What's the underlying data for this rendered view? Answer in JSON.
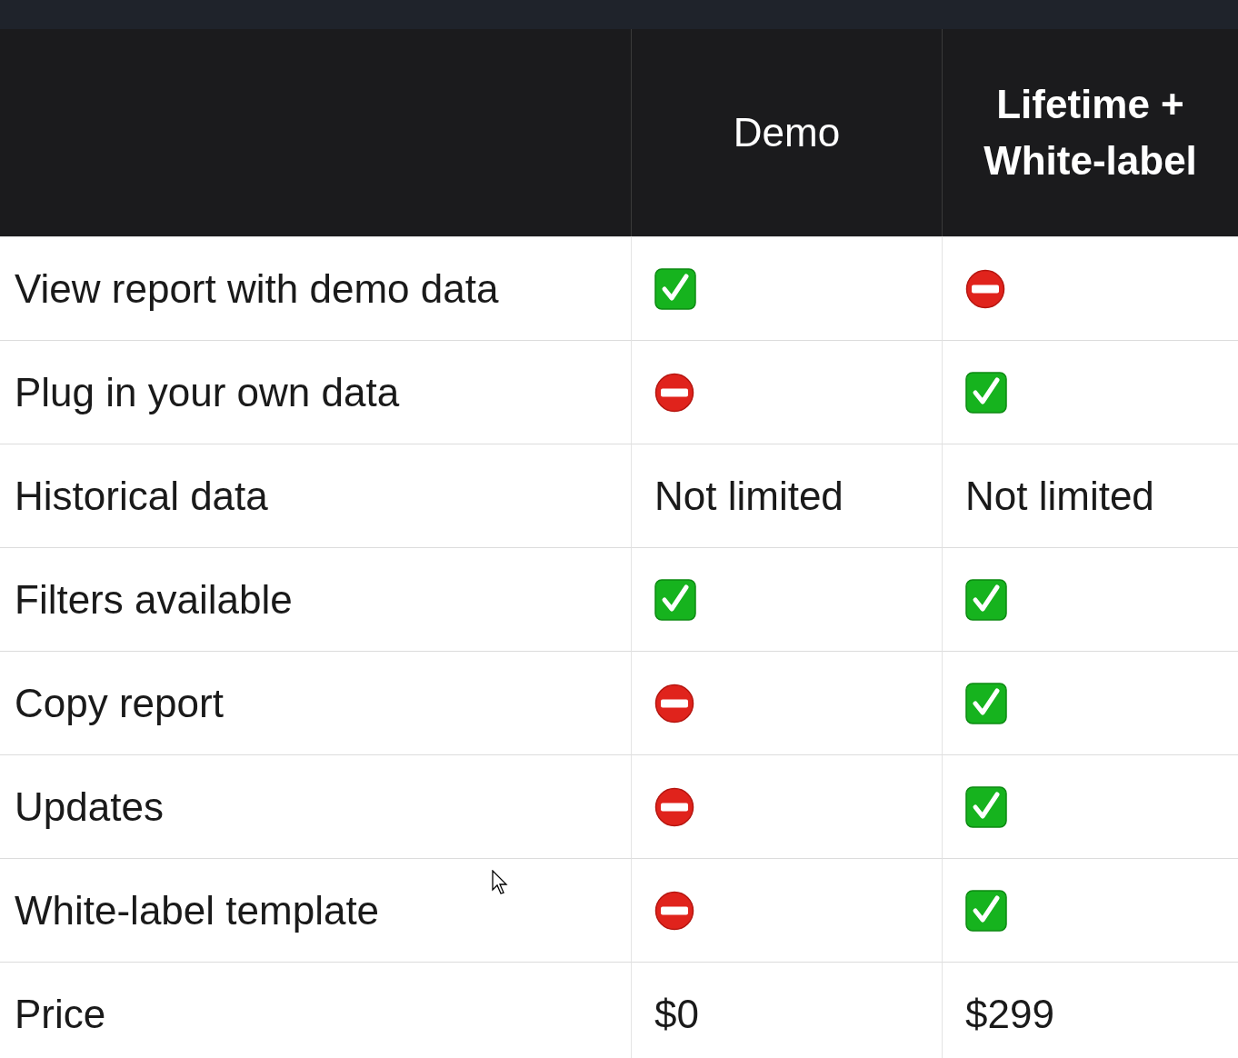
{
  "table": {
    "columns": [
      {
        "label": "Demo",
        "highlighted": false
      },
      {
        "label": "Lifetime + White-label",
        "highlighted": true
      }
    ],
    "rows": [
      {
        "feature": "View report with demo data",
        "cells": [
          {
            "kind": "yes"
          },
          {
            "kind": "no"
          }
        ]
      },
      {
        "feature": "Plug in your own data",
        "cells": [
          {
            "kind": "no"
          },
          {
            "kind": "yes"
          }
        ]
      },
      {
        "feature": "Historical data",
        "cells": [
          {
            "kind": "text",
            "text": "Not limited"
          },
          {
            "kind": "text",
            "text": "Not limited"
          }
        ]
      },
      {
        "feature": "Filters available",
        "cells": [
          {
            "kind": "yes"
          },
          {
            "kind": "yes"
          }
        ]
      },
      {
        "feature": "Copy report",
        "cells": [
          {
            "kind": "no"
          },
          {
            "kind": "yes"
          }
        ]
      },
      {
        "feature": "Updates",
        "cells": [
          {
            "kind": "no"
          },
          {
            "kind": "yes"
          }
        ]
      },
      {
        "feature": "White-label template",
        "cells": [
          {
            "kind": "no"
          },
          {
            "kind": "yes"
          }
        ]
      },
      {
        "feature": "Price",
        "cells": [
          {
            "kind": "text",
            "text": "$0"
          },
          {
            "kind": "text",
            "text": "$299"
          }
        ]
      }
    ]
  }
}
